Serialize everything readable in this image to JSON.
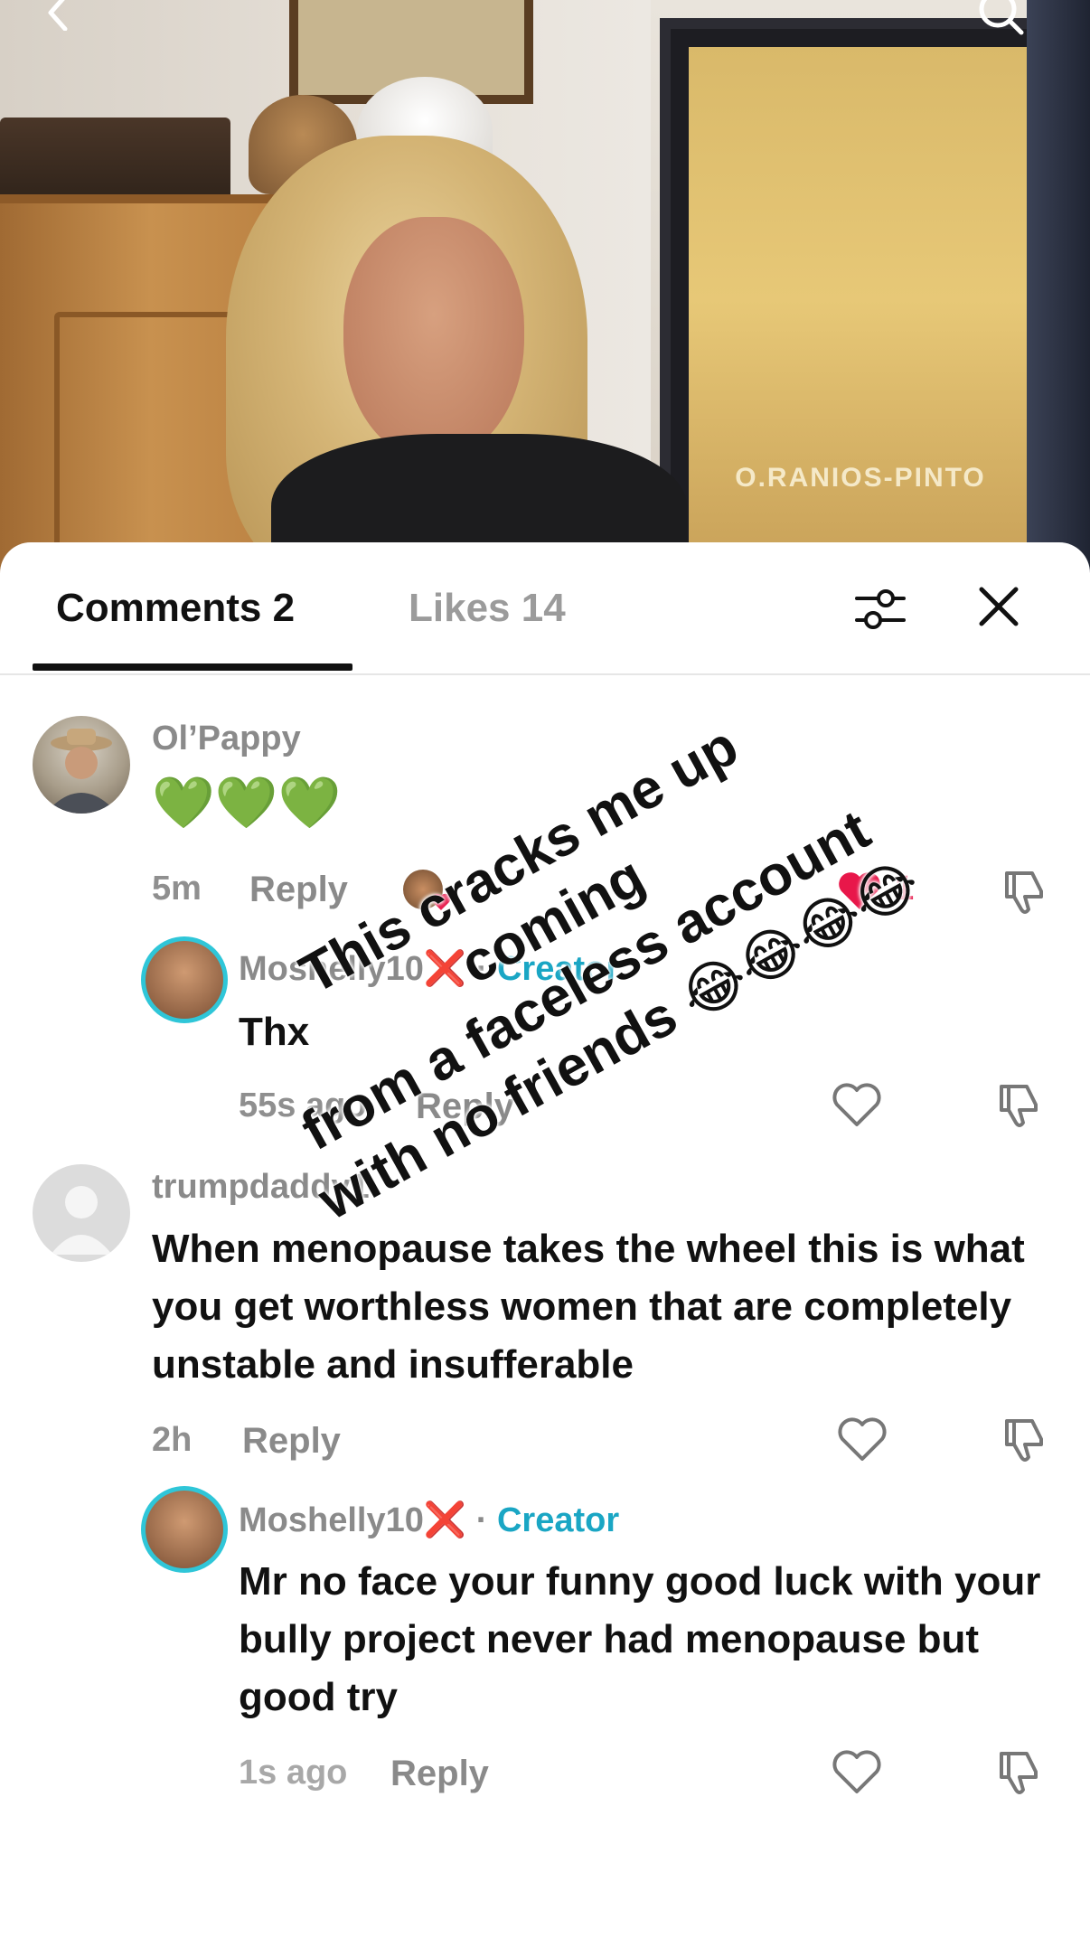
{
  "tabs": {
    "comments_label": "Comments 2",
    "likes_label": "Likes 14"
  },
  "comments": [
    {
      "username": "Ol’Pappy",
      "text": "💚💚💚",
      "time": "5m",
      "reply_label": "Reply",
      "like_count": "1",
      "replies": [
        {
          "username": "Moshelly10",
          "x_mark": "❌",
          "separator": "·",
          "badge": "Creator",
          "text": "Thx",
          "time": "55s ago",
          "reply_label": "Reply"
        }
      ]
    },
    {
      "username": "trumpdaddy1",
      "text": "When menopause takes the wheel this is what you get worthless women that are completely unstable and insufferable",
      "time": "2h",
      "reply_label": "Reply",
      "replies": [
        {
          "username": "Moshelly10",
          "x_mark": "❌",
          "separator": "·",
          "badge": "Creator",
          "text": "Mr no face your funny good luck with your bully project never had menopause but good try",
          "time": "1s ago",
          "reply_label": "Reply"
        }
      ]
    }
  ],
  "overlay": {
    "line1": "This cracks me up coming",
    "line2": "from a faceless account",
    "line3": "with no friends 😂😂😂😂"
  },
  "video": {
    "poster_text": "O.RANIOS-PINTO"
  },
  "colors": {
    "creator": "#1aa6c4",
    "like_red": "#e8174a",
    "muted": "#8a8a8a"
  }
}
